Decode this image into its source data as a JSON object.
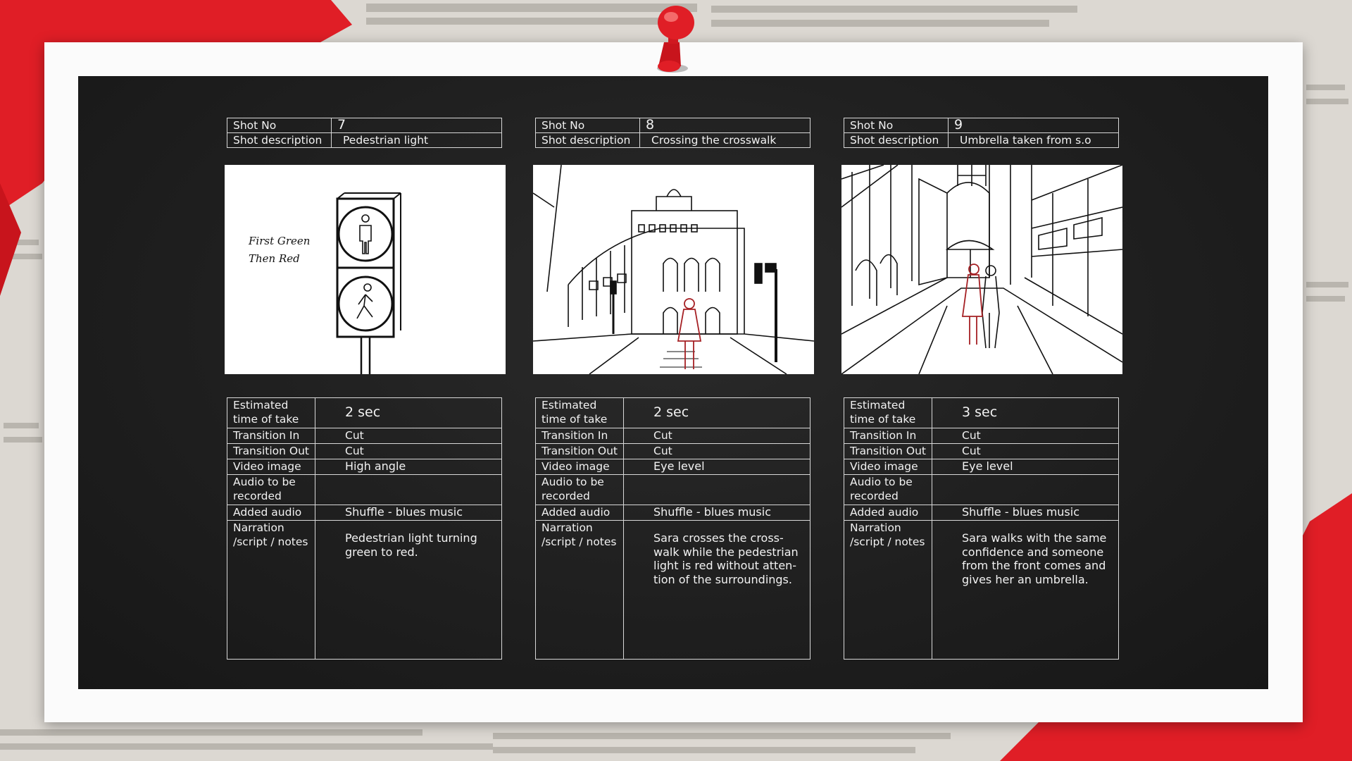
{
  "shots": [
    {
      "shot_no_label": "Shot No",
      "shot_no": "7",
      "desc_label": "Shot description",
      "desc": "Pedestrian light",
      "sketch_note_line1": "First Green",
      "sketch_note_line2": "Then Red",
      "rows": {
        "time_label": "Estimated\ntime of take",
        "time": "2 sec",
        "trans_in_label": "Transition In",
        "trans_in": "Cut",
        "trans_out_label": "Transition Out",
        "trans_out": "Cut",
        "video_label": "Video image",
        "video": "High angle",
        "audio_rec_label": "Audio to be\nrecorded",
        "audio_rec": "",
        "added_audio_label": "Added audio",
        "added_audio": "Shuffle - blues music",
        "notes_label": "Narration\n/script / notes",
        "notes": "Pedestrian light turning\ngreen to red."
      }
    },
    {
      "shot_no_label": "Shot No",
      "shot_no": "8",
      "desc_label": "Shot description",
      "desc": "Crossing the crosswalk",
      "rows": {
        "time_label": "Estimated\ntime of take",
        "time": "2 sec",
        "trans_in_label": "Transition In",
        "trans_in": "Cut",
        "trans_out_label": "Transition Out",
        "trans_out": "Cut",
        "video_label": "Video image",
        "video": "Eye level",
        "audio_rec_label": "Audio to be\nrecorded",
        "audio_rec": "",
        "added_audio_label": "Added audio",
        "added_audio": "Shuffle - blues music",
        "notes_label": "Narration\n/script / notes",
        "notes": "Sara crosses the cross-\nwalk while the pedestrian\nlight is red without atten-\ntion of the surroundings."
      }
    },
    {
      "shot_no_label": "Shot No",
      "shot_no": "9",
      "desc_label": "Shot description",
      "desc": "Umbrella taken from s.o",
      "rows": {
        "time_label": "Estimated\ntime of take",
        "time": "3 sec",
        "trans_in_label": "Transition In",
        "trans_in": "Cut",
        "trans_out_label": "Transition Out",
        "trans_out": "Cut",
        "video_label": "Video image",
        "video": "Eye level",
        "audio_rec_label": "Audio to be\nrecorded",
        "audio_rec": "",
        "added_audio_label": "Added audio",
        "added_audio": "Shuffle - blues music",
        "notes_label": "Narration\n/script / notes",
        "notes": "Sara walks with the same\nconfidence and someone\nfrom the front comes and\ngives her an umbrella."
      }
    }
  ],
  "colors": {
    "board": "#1f1f1f",
    "accent_red": "#e01e26",
    "sketch_red": "#a52024",
    "line": "#d8d8d8"
  }
}
